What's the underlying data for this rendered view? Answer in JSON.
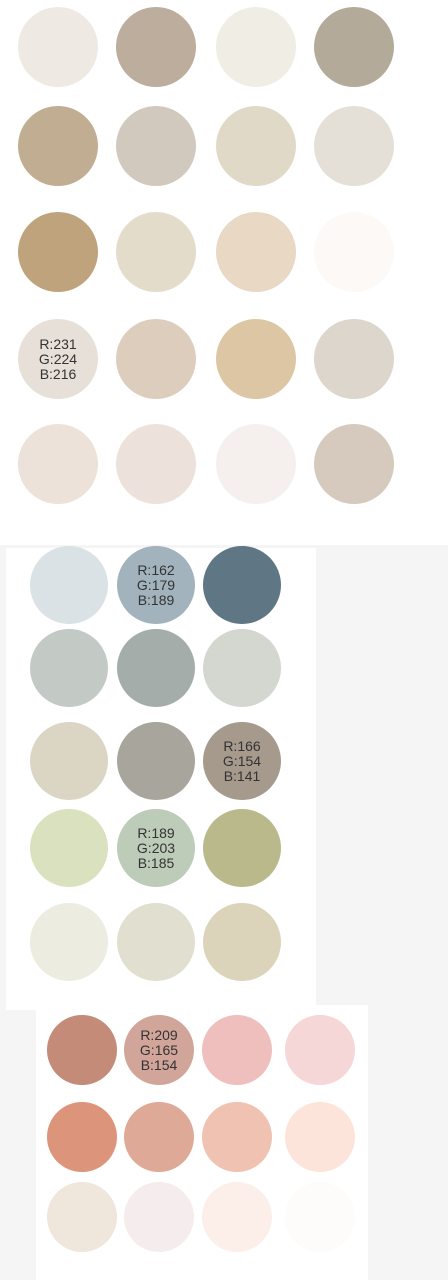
{
  "palette_1": {
    "swatches": [
      {
        "color": "#efe9e4"
      },
      {
        "color": "#bcad9c"
      },
      {
        "color": "#efede4"
      },
      {
        "color": "#b3aa9a"
      },
      {
        "color": "#c0ad92"
      },
      {
        "color": "#d2c9be"
      },
      {
        "color": "#e1d9c8"
      },
      {
        "color": "#e5e0d7"
      },
      {
        "color": "#bea37c"
      },
      {
        "color": "#e4dcca"
      },
      {
        "color": "#e9d8c4"
      },
      {
        "color": "#fcf9f7"
      },
      {
        "color": "#e7e0d8",
        "label": "R:231\nG:224\nB:216"
      },
      {
        "color": "#ddcdbd"
      },
      {
        "color": "#dcc6a3"
      },
      {
        "color": "#dcd6cc"
      },
      {
        "color": "#ece2d9"
      },
      {
        "color": "#ece2db"
      },
      {
        "color": "#f5f0ee"
      },
      {
        "color": "#d6cabe"
      }
    ]
  },
  "palette_2": {
    "swatches": [
      {
        "color": "#dae2e6"
      },
      {
        "color": "#a2b3bd",
        "label": "R:162\nG:179\nB:189"
      },
      {
        "color": "#5f7685"
      },
      {
        "color": "#c3cac6"
      },
      {
        "color": "#a5adaa"
      },
      {
        "color": "#d4d6d0"
      },
      {
        "color": "#dbd6c4"
      },
      {
        "color": "#a8a59d"
      },
      {
        "color": "#a69a8d",
        "label": "R:166\nG:154\nB:141"
      },
      {
        "color": "#dae1bf"
      },
      {
        "color": "#bdcbb9",
        "label": "R:189\nG:203\nB:185"
      },
      {
        "color": "#b9b98b"
      },
      {
        "color": "#ecede0"
      },
      {
        "color": "#e1e0d0"
      },
      {
        "color": "#dbd4bb"
      }
    ]
  },
  "palette_3": {
    "swatches": [
      {
        "color": "#c48b79"
      },
      {
        "color": "#d1a59a",
        "label": "R:209\nG:165\nB:154"
      },
      {
        "color": "#efbfbd"
      },
      {
        "color": "#f5d7d7"
      },
      {
        "color": "#dc957b"
      },
      {
        "color": "#dea996"
      },
      {
        "color": "#f0c2b2"
      },
      {
        "color": "#fde4da"
      },
      {
        "color": "#efe6dc"
      },
      {
        "color": "#f5eced"
      },
      {
        "color": "#fcefe9"
      },
      {
        "color": "#fdfcfa"
      }
    ]
  }
}
